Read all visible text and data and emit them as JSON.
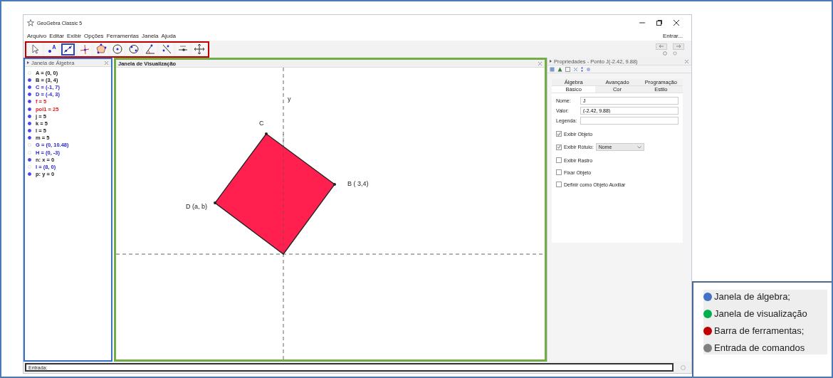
{
  "window": {
    "title": "GeoGebra Classic 5",
    "menu": [
      "Arquivo",
      "Editar",
      "Exibir",
      "Opções",
      "Ferramentas",
      "Janela",
      "Ajuda"
    ],
    "login": "Entrar..."
  },
  "toolbar": {
    "tools": [
      {
        "kind": "move",
        "selected": false
      },
      {
        "kind": "point",
        "selected": false
      },
      {
        "kind": "line",
        "selected": true
      },
      {
        "kind": "perpendicular",
        "selected": false
      },
      {
        "kind": "polygon",
        "selected": false
      },
      {
        "kind": "circle",
        "selected": false
      },
      {
        "kind": "conic",
        "selected": false
      },
      {
        "kind": "angle",
        "selected": false
      },
      {
        "kind": "reflect",
        "selected": false
      },
      {
        "kind": "slider",
        "selected": false
      },
      {
        "kind": "pan",
        "selected": false
      }
    ]
  },
  "algebra": {
    "title": "Janela de Álgebra",
    "items": [
      {
        "text": "A = (0, 0)",
        "color": "#222222",
        "shown": false
      },
      {
        "text": "B = (3, 4)",
        "color": "#222222",
        "shown": true
      },
      {
        "text": "C = (-1, 7)",
        "color": "#2a2ad0",
        "shown": true
      },
      {
        "text": "D = (-4, 3)",
        "color": "#2a2ad0",
        "shown": true
      },
      {
        "text": "f = 5",
        "color": "#e02020",
        "shown": true
      },
      {
        "text": "pol1 = 25",
        "color": "#e02020",
        "shown": true
      },
      {
        "text": "j = 5",
        "color": "#222222",
        "shown": true
      },
      {
        "text": "k = 5",
        "color": "#222222",
        "shown": true
      },
      {
        "text": "l = 5",
        "color": "#222222",
        "shown": true
      },
      {
        "text": "m = 5",
        "color": "#222222",
        "shown": true
      },
      {
        "text": "G = (0, 10.48)",
        "color": "#2a2ad0",
        "shown": false
      },
      {
        "text": "H = (0, -3)",
        "color": "#2a2ad0",
        "shown": false
      },
      {
        "text": "n: x = 0",
        "color": "#222222",
        "shown": true
      },
      {
        "text": "I = (8, 0)",
        "color": "#2a2ad0",
        "shown": false
      },
      {
        "text": "p: y = 0",
        "color": "#222222",
        "shown": true
      }
    ]
  },
  "graphics": {
    "title": "Janela de Visualização",
    "axis_label": "y",
    "labels": [
      "C",
      "B ( 3,4)",
      "D (a, b)"
    ]
  },
  "properties": {
    "title": "Propriedades - Ponto J(-2.42, 9.88)",
    "tabs_row_1": [
      {
        "label": "Álgebra",
        "selected": false
      },
      {
        "label": "Avançado",
        "selected": false
      },
      {
        "label": "Programação",
        "selected": false
      }
    ],
    "tabs_row_2": [
      {
        "label": "Básico",
        "selected": true
      },
      {
        "label": "Cor",
        "selected": false
      },
      {
        "label": "Estilo",
        "selected": false
      }
    ],
    "fields": [
      {
        "label": "Nome:",
        "value": "J"
      },
      {
        "label": "Valor:",
        "value": "(-2.42, 9.88)"
      },
      {
        "label": "Legenda:"
      }
    ],
    "checks": [
      {
        "label": "Exibir Objeto",
        "checked": true
      },
      {
        "label": "Exibir Rótulo:",
        "checked": true,
        "select": "Nome"
      },
      {
        "label": "Exibir Rastro",
        "checked": false
      },
      {
        "label": "Fixar Objeto",
        "checked": false
      },
      {
        "label": "Definir como Objeto Auxiliar",
        "checked": false
      }
    ]
  },
  "input_bar": {
    "label": "Entrada:"
  },
  "legend": [
    {
      "text": "Janela de álgebra;",
      "color": "#4472c4"
    },
    {
      "text": "Janela de visualização",
      "color": "#00b050"
    },
    {
      "text": "Barra de ferramentas;",
      "color": "#c00000"
    },
    {
      "text": "Entrada de comandos",
      "color": "#808080"
    }
  ]
}
